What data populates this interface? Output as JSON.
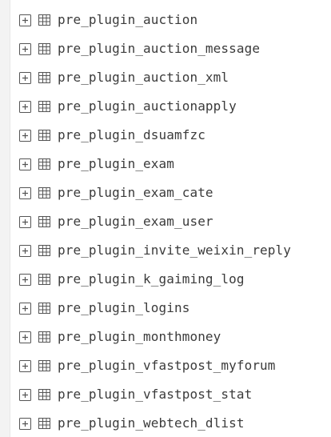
{
  "tree": {
    "items": [
      {
        "label": "pre_plugin_auction",
        "icon": "table-icon",
        "expander": "expand-plus-icon"
      },
      {
        "label": "pre_plugin_auction_message",
        "icon": "table-icon",
        "expander": "expand-plus-icon"
      },
      {
        "label": "pre_plugin_auction_xml",
        "icon": "table-icon",
        "expander": "expand-plus-icon"
      },
      {
        "label": "pre_plugin_auctionapply",
        "icon": "table-icon",
        "expander": "expand-plus-icon"
      },
      {
        "label": "pre_plugin_dsuamfzc",
        "icon": "table-icon",
        "expander": "expand-plus-icon"
      },
      {
        "label": "pre_plugin_exam",
        "icon": "table-icon",
        "expander": "expand-plus-icon"
      },
      {
        "label": "pre_plugin_exam_cate",
        "icon": "table-icon",
        "expander": "expand-plus-icon"
      },
      {
        "label": "pre_plugin_exam_user",
        "icon": "table-icon",
        "expander": "expand-plus-icon"
      },
      {
        "label": "pre_plugin_invite_weixin_reply",
        "icon": "table-icon",
        "expander": "expand-plus-icon"
      },
      {
        "label": "pre_plugin_k_gaiming_log",
        "icon": "table-icon",
        "expander": "expand-plus-icon"
      },
      {
        "label": "pre_plugin_logins",
        "icon": "table-icon",
        "expander": "expand-plus-icon"
      },
      {
        "label": "pre_plugin_monthmoney",
        "icon": "table-icon",
        "expander": "expand-plus-icon"
      },
      {
        "label": "pre_plugin_vfastpost_myforum",
        "icon": "table-icon",
        "expander": "expand-plus-icon"
      },
      {
        "label": "pre_plugin_vfastpost_stat",
        "icon": "table-icon",
        "expander": "expand-plus-icon"
      },
      {
        "label": "pre_plugin_webtech_dlist",
        "icon": "table-icon",
        "expander": "expand-plus-icon"
      }
    ]
  },
  "colors": {
    "text": "#3b3b3b",
    "icon": "#555555",
    "background": "#ffffff",
    "gutter": "#f3f3f3"
  }
}
